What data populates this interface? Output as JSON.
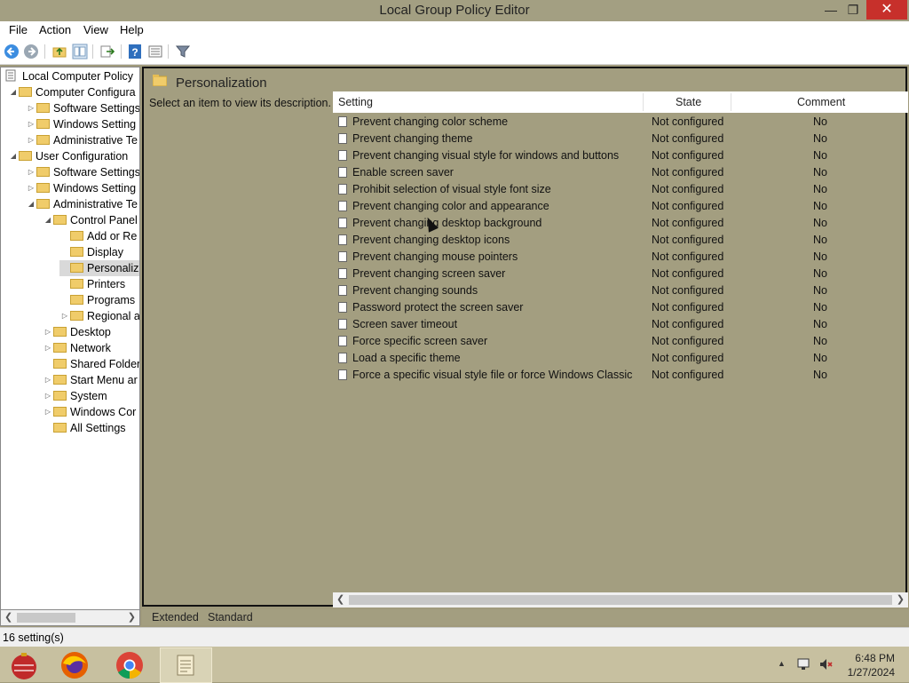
{
  "window": {
    "title": "Local Group Policy Editor",
    "minimize": "—",
    "maximize": "❐",
    "close": "✕"
  },
  "menu": [
    "File",
    "Action",
    "View",
    "Help"
  ],
  "toolbar_icons": [
    "back-icon",
    "forward-icon",
    "up-folder-icon",
    "show-hide-tree-icon",
    "export-list-icon",
    "help-icon",
    "properties-icon",
    "filter-icon"
  ],
  "tree": {
    "root": "Local Computer Policy",
    "nodes": [
      {
        "label": "Computer Configura",
        "level": 1,
        "expander": "◢"
      },
      {
        "label": "Software Settings",
        "level": 2,
        "expander": "▷"
      },
      {
        "label": "Windows Setting",
        "level": 2,
        "expander": "▷"
      },
      {
        "label": "Administrative Te",
        "level": 2,
        "expander": "▷"
      },
      {
        "label": "User Configuration",
        "level": 1,
        "expander": "◢"
      },
      {
        "label": "Software Settings",
        "level": 2,
        "expander": "▷"
      },
      {
        "label": "Windows Setting",
        "level": 2,
        "expander": "▷"
      },
      {
        "label": "Administrative Te",
        "level": 2,
        "expander": "◢"
      },
      {
        "label": "Control Panel",
        "level": 3,
        "expander": "◢"
      },
      {
        "label": "Add or Re",
        "level": 4,
        "expander": ""
      },
      {
        "label": "Display",
        "level": 4,
        "expander": ""
      },
      {
        "label": "Personalizi",
        "level": 4,
        "expander": "",
        "selected": true
      },
      {
        "label": "Printers",
        "level": 4,
        "expander": ""
      },
      {
        "label": "Programs",
        "level": 4,
        "expander": ""
      },
      {
        "label": "Regional a",
        "level": 4,
        "expander": "▷"
      },
      {
        "label": "Desktop",
        "level": 3,
        "expander": "▷"
      },
      {
        "label": "Network",
        "level": 3,
        "expander": "▷"
      },
      {
        "label": "Shared Folder",
        "level": 3,
        "expander": ""
      },
      {
        "label": "Start Menu ar",
        "level": 3,
        "expander": "▷"
      },
      {
        "label": "System",
        "level": 3,
        "expander": "▷"
      },
      {
        "label": "Windows Cor",
        "level": 3,
        "expander": "▷"
      },
      {
        "label": "All Settings",
        "level": 3,
        "expander": ""
      }
    ]
  },
  "details": {
    "title": "Personalization",
    "description": "Select an item to view its description.",
    "columns": {
      "setting": "Setting",
      "state": "State",
      "comment": "Comment"
    },
    "rows": [
      {
        "setting": "Prevent changing color scheme",
        "state": "Not configured",
        "comment": "No"
      },
      {
        "setting": "Prevent changing theme",
        "state": "Not configured",
        "comment": "No"
      },
      {
        "setting": "Prevent changing visual style for windows and buttons",
        "state": "Not configured",
        "comment": "No"
      },
      {
        "setting": "Enable screen saver",
        "state": "Not configured",
        "comment": "No"
      },
      {
        "setting": "Prohibit selection of visual style font size",
        "state": "Not configured",
        "comment": "No"
      },
      {
        "setting": "Prevent changing color and appearance",
        "state": "Not configured",
        "comment": "No"
      },
      {
        "setting": "Prevent changing desktop background",
        "state": "Not configured",
        "comment": "No"
      },
      {
        "setting": "Prevent changing desktop icons",
        "state": "Not configured",
        "comment": "No"
      },
      {
        "setting": "Prevent changing mouse pointers",
        "state": "Not configured",
        "comment": "No"
      },
      {
        "setting": "Prevent changing screen saver",
        "state": "Not configured",
        "comment": "No"
      },
      {
        "setting": "Prevent changing sounds",
        "state": "Not configured",
        "comment": "No"
      },
      {
        "setting": "Password protect the screen saver",
        "state": "Not configured",
        "comment": "No"
      },
      {
        "setting": "Screen saver timeout",
        "state": "Not configured",
        "comment": "No"
      },
      {
        "setting": "Force specific screen saver",
        "state": "Not configured",
        "comment": "No"
      },
      {
        "setting": "Load a specific theme",
        "state": "Not configured",
        "comment": "No"
      },
      {
        "setting": "Force a specific visual style file or force Windows Classic",
        "state": "Not configured",
        "comment": "No"
      }
    ]
  },
  "tabs": [
    "Extended",
    "Standard"
  ],
  "status": "16 setting(s)",
  "taskbar": {
    "apps": [
      "ornament-app-icon",
      "firefox-icon",
      "chrome-icon",
      "notepad-icon"
    ],
    "time": "6:48 PM",
    "date": "1/27/2024"
  },
  "colors": {
    "window_chrome": "#a39f82",
    "close_button": "#c7302b",
    "folder": "#f0cc6a"
  }
}
